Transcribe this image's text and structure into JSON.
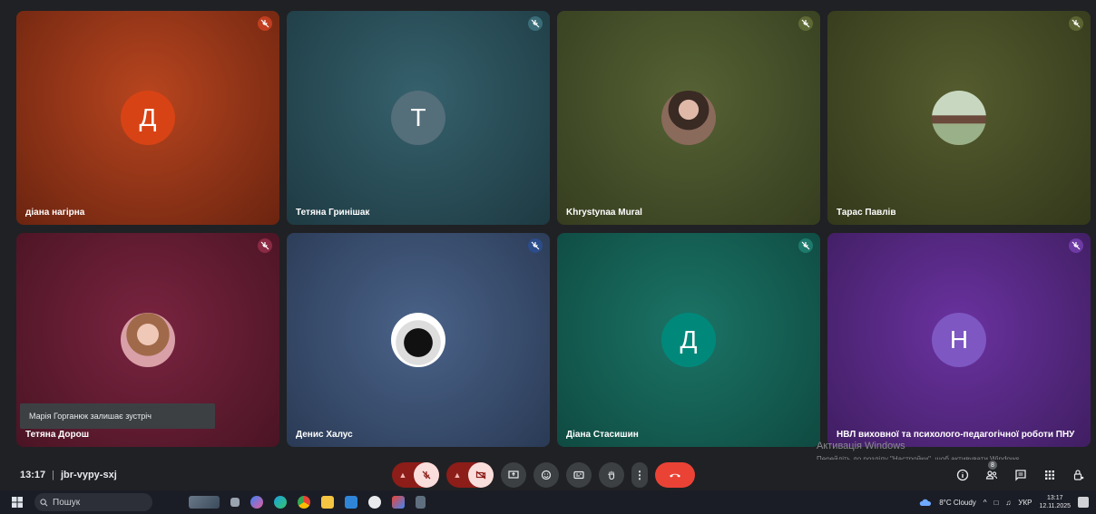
{
  "participants": [
    {
      "name": "діана нагірна",
      "initial": "Д",
      "bg": "#a8371a",
      "bg2": "#6b2410",
      "avatar_color": "#d84315",
      "mic": "#c13e20"
    },
    {
      "name": "Тетяна Гринішак",
      "initial": "Т",
      "bg": "#2f5560",
      "bg2": "#1e3a42",
      "avatar_color": "#546e7a",
      "mic": "#3a6d78"
    },
    {
      "name": "Khrystynaa Mural",
      "initial": "",
      "bg": "#4f5a2e",
      "bg2": "#353d1f",
      "avatar_color": "#7b6a5a",
      "mic": "#5e6a36"
    },
    {
      "name": "Тарас Павлів",
      "initial": "",
      "bg": "#4c5229",
      "bg2": "#33381b",
      "avatar_color": "#8aa07a",
      "mic": "#5d6433"
    },
    {
      "name": "Тетяна Дорош",
      "initial": "",
      "bg": "#6e1f35",
      "bg2": "#4a1424",
      "avatar_color": "#b07a70",
      "mic": "#8a2a44"
    },
    {
      "name": "Денис Халус",
      "initial": "",
      "bg": "#3e5478",
      "bg2": "#2a3a55",
      "avatar_color": "#222",
      "mic": "#2c4d8a"
    },
    {
      "name": "Діана Стасишин",
      "initial": "Д",
      "bg": "#17665a",
      "bg2": "#0f4a41",
      "avatar_color": "#00897b",
      "mic": "#1d7a6c"
    },
    {
      "name": "НВЛ виховної та психолого-педагогічної роботи ПНУ",
      "initial": "Н",
      "bg": "#5b2b8a",
      "bg2": "#401e62",
      "avatar_color": "#7e57c2",
      "mic": "#6e3aa4"
    }
  ],
  "toast": "Марія Горганюк залишає зустріч",
  "meeting": {
    "time": "13:17",
    "code": "jbr-vypy-sxj"
  },
  "watermark": {
    "title": "Активація Windows",
    "subtitle": "Перейдіть до розділу \"Настройки\", щоб активувати Windows."
  },
  "right_badge": "8",
  "taskbar": {
    "search": "Пошук",
    "weather": "8°C Cloudy",
    "lang": "УКР",
    "time": "13:17",
    "date": "12.11.2025"
  }
}
